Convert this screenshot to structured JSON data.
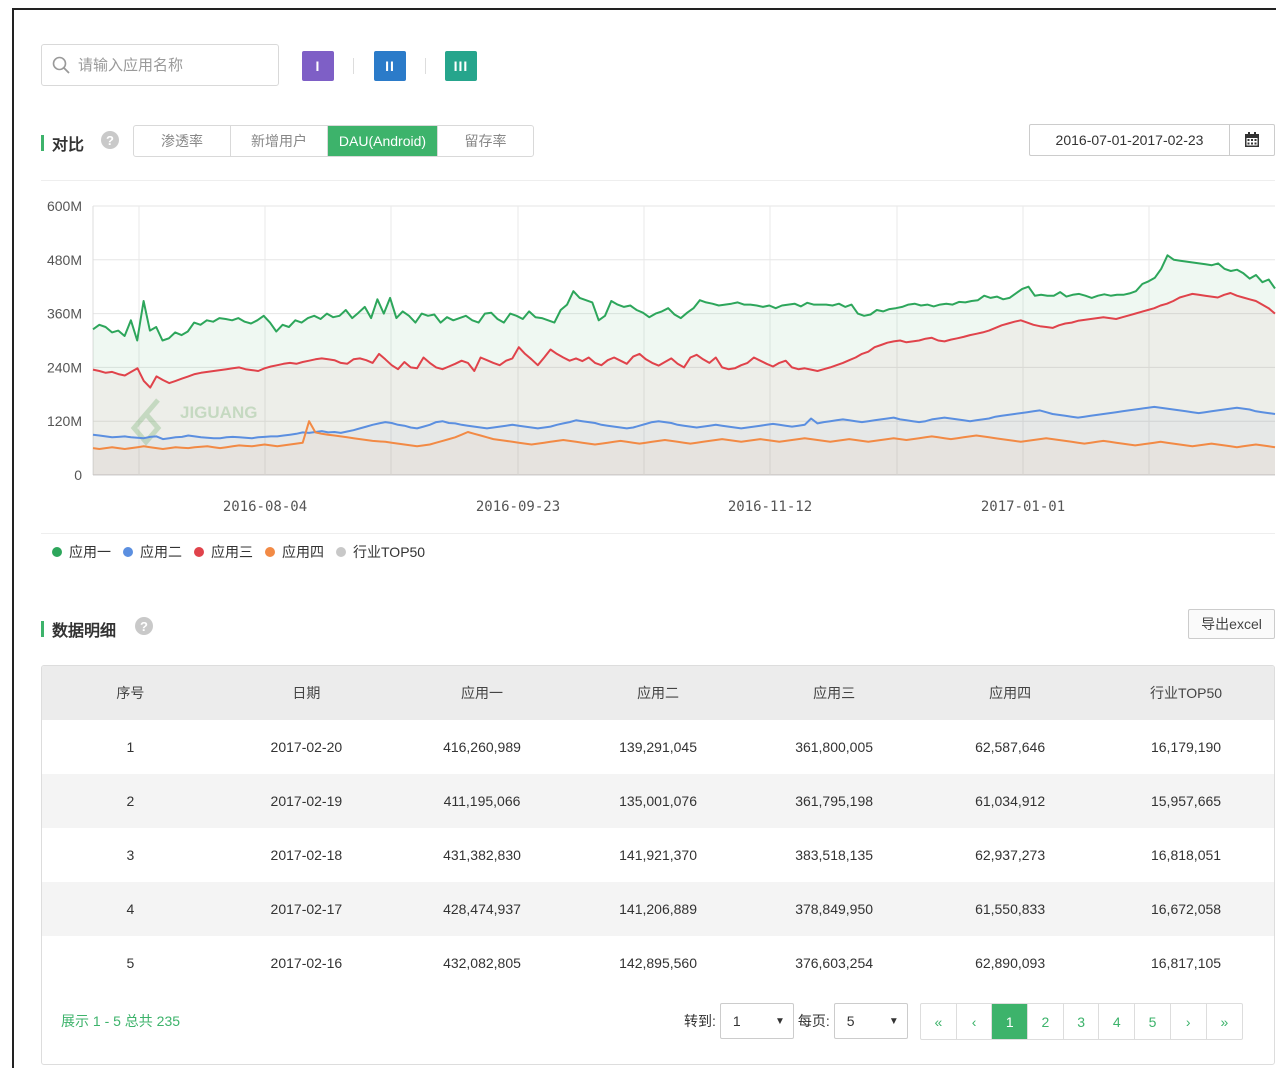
{
  "search": {
    "placeholder": "请输入应用名称"
  },
  "view_buttons": [
    {
      "label": "I",
      "color": "#7e5fc6"
    },
    {
      "label": "II",
      "color": "#2b7bc9"
    },
    {
      "label": "III",
      "color": "#26a58c"
    }
  ],
  "compare": {
    "title": "对比",
    "tabs": [
      "渗透率",
      "新增用户",
      "DAU(Android)",
      "留存率"
    ],
    "active_tab": "DAU(Android)",
    "date_range": "2016-07-01-2017-02-23"
  },
  "watermark": {
    "text": "JIGUANG"
  },
  "chart_data": {
    "type": "area",
    "x_ticks": [
      "2016-08-04",
      "2016-09-23",
      "2016-11-12",
      "2017-01-01"
    ],
    "y_ticks": [
      "0",
      "120M",
      "240M",
      "360M",
      "480M",
      "600M"
    ],
    "ylim": [
      0,
      600000000
    ],
    "x_range": [
      "2016-07-01",
      "2017-02-23"
    ],
    "grid": true,
    "legend_position": "bottom-left",
    "series": [
      {
        "name": "应用一",
        "color": "#2da65b",
        "values": [
          325,
          335,
          330,
          318,
          322,
          310,
          345,
          300,
          388,
          322,
          330,
          300,
          305,
          318,
          312,
          320,
          340,
          335,
          345,
          342,
          350,
          348,
          345,
          350,
          342,
          338,
          345,
          355,
          340,
          320,
          335,
          330,
          345,
          340,
          350,
          355,
          348,
          360,
          352,
          355,
          368,
          350,
          362,
          375,
          350,
          392,
          360,
          395,
          350,
          365,
          355,
          340,
          360,
          355,
          358,
          340,
          352,
          345,
          350,
          355,
          345,
          340,
          360,
          362,
          348,
          340,
          360,
          355,
          348,
          365,
          352,
          350,
          345,
          340,
          368,
          380,
          410,
          395,
          390,
          385,
          345,
          355,
          388,
          380,
          375,
          378,
          368,
          362,
          352,
          360,
          365,
          372,
          358,
          350,
          362,
          372,
          390,
          385,
          382,
          378,
          380,
          382,
          385,
          380,
          380,
          378,
          375,
          378,
          372,
          378,
          380,
          382,
          376,
          384,
          380,
          380,
          380,
          378,
          382,
          375,
          380,
          360,
          355,
          358,
          368,
          365,
          370,
          372,
          375,
          380,
          382,
          378,
          380,
          376,
          380,
          382,
          380,
          386,
          385,
          388,
          390,
          400,
          395,
          398,
          392,
          395,
          405,
          415,
          420,
          400,
          402,
          400,
          400,
          408,
          398,
          402,
          404,
          400,
          395,
          400,
          403,
          400,
          402,
          402,
          405,
          410,
          426,
          432,
          440,
          460,
          490,
          480,
          478,
          476,
          474,
          472,
          470,
          468,
          472,
          460,
          455,
          458,
          450,
          438,
          446,
          430,
          436,
          416
        ]
      },
      {
        "name": "应用二",
        "color": "#5b8fe0",
        "values": [
          90,
          88,
          86,
          84,
          85,
          86,
          84,
          83,
          82,
          85,
          86,
          80,
          82,
          84,
          85,
          88,
          86,
          84,
          83,
          82,
          82,
          84,
          85,
          84,
          83,
          82,
          84,
          85,
          86,
          86,
          88,
          90,
          92,
          95,
          94,
          96,
          98,
          95,
          96,
          94,
          97,
          100,
          104,
          108,
          112,
          115,
          118,
          116,
          112,
          110,
          106,
          104,
          108,
          112,
          118,
          120,
          116,
          115,
          112,
          110,
          108,
          106,
          104,
          106,
          108,
          110,
          112,
          110,
          108,
          106,
          104,
          106,
          108,
          112,
          115,
          118,
          122,
          120,
          118,
          116,
          112,
          110,
          108,
          106,
          104,
          106,
          110,
          114,
          118,
          120,
          118,
          116,
          112,
          110,
          108,
          106,
          108,
          110,
          112,
          110,
          108,
          106,
          104,
          106,
          108,
          110,
          112,
          114,
          112,
          110,
          108,
          110,
          112,
          126,
          115,
          118,
          120,
          122,
          124,
          122,
          120,
          118,
          120,
          122,
          124,
          126,
          128,
          124,
          122,
          120,
          118,
          120,
          124,
          126,
          128,
          126,
          124,
          122,
          120,
          122,
          124,
          126,
          130,
          132,
          134,
          136,
          138,
          140,
          142,
          144,
          140,
          136,
          134,
          132,
          130,
          128,
          130,
          132,
          134,
          136,
          138,
          140,
          142,
          144,
          146,
          148,
          150,
          152,
          150,
          148,
          146,
          144,
          142,
          140,
          138,
          140,
          142,
          144,
          146,
          148,
          150,
          148,
          146,
          142,
          140,
          138,
          136
        ]
      },
      {
        "name": "应用三",
        "color": "#e0434b",
        "values": [
          235,
          232,
          228,
          230,
          225,
          222,
          230,
          238,
          210,
          195,
          220,
          212,
          205,
          210,
          215,
          220,
          225,
          228,
          230,
          232,
          234,
          236,
          238,
          240,
          236,
          234,
          232,
          238,
          242,
          245,
          248,
          250,
          248,
          252,
          255,
          258,
          260,
          258,
          256,
          250,
          248,
          258,
          260,
          256,
          250,
          270,
          258,
          245,
          236,
          252,
          240,
          238,
          262,
          250,
          240,
          236,
          242,
          248,
          255,
          250,
          232,
          262,
          256,
          250,
          245,
          255,
          260,
          285,
          270,
          258,
          245,
          262,
          280,
          270,
          262,
          255,
          260,
          254,
          262,
          250,
          245,
          256,
          262,
          255,
          248,
          264,
          270,
          258,
          250,
          244,
          252,
          260,
          248,
          240,
          262,
          268,
          258,
          250,
          262,
          240,
          236,
          238,
          245,
          250,
          262,
          255,
          248,
          242,
          250,
          255,
          240,
          236,
          238,
          235,
          232,
          236,
          240,
          245,
          250,
          256,
          262,
          270,
          275,
          285,
          290,
          295,
          298,
          300,
          296,
          298,
          300,
          304,
          306,
          300,
          298,
          302,
          305,
          308,
          312,
          315,
          318,
          322,
          328,
          334,
          338,
          342,
          345,
          340,
          335,
          332,
          330,
          328,
          334,
          338,
          340,
          344,
          346,
          348,
          350,
          352,
          350,
          348,
          352,
          356,
          360,
          364,
          368,
          372,
          378,
          382,
          388,
          396,
          400,
          404,
          402,
          400,
          398,
          396,
          402,
          406,
          400,
          396,
          392,
          388,
          380,
          372,
          360
        ]
      },
      {
        "name": "应用四",
        "color": "#f28a45",
        "values": [
          60,
          58,
          60,
          62,
          60,
          58,
          60,
          62,
          64,
          62,
          60,
          58,
          60,
          62,
          61,
          60,
          62,
          63,
          64,
          62,
          60,
          62,
          64,
          66,
          65,
          64,
          66,
          68,
          66,
          64,
          66,
          68,
          70,
          72,
          120,
          95,
          92,
          90,
          88,
          86,
          84,
          82,
          80,
          78,
          76,
          75,
          74,
          72,
          70,
          68,
          66,
          64,
          66,
          68,
          72,
          76,
          80,
          84,
          90,
          96,
          92,
          88,
          84,
          80,
          78,
          76,
          74,
          72,
          70,
          68,
          70,
          72,
          74,
          76,
          78,
          76,
          74,
          72,
          70,
          68,
          70,
          72,
          74,
          76,
          74,
          72,
          70,
          72,
          74,
          76,
          78,
          76,
          74,
          72,
          70,
          72,
          74,
          76,
          78,
          80,
          78,
          76,
          74,
          76,
          78,
          80,
          78,
          76,
          74,
          76,
          78,
          80,
          82,
          80,
          78,
          76,
          74,
          76,
          78,
          80,
          78,
          76,
          74,
          76,
          78,
          80,
          82,
          80,
          78,
          80,
          82,
          84,
          86,
          84,
          82,
          80,
          82,
          84,
          86,
          88,
          86,
          84,
          82,
          80,
          78,
          76,
          74,
          76,
          78,
          80,
          82,
          80,
          78,
          76,
          74,
          72,
          70,
          72,
          74,
          76,
          74,
          72,
          70,
          68,
          66,
          68,
          70,
          72,
          74,
          72,
          70,
          68,
          66,
          64,
          66,
          68,
          70,
          68,
          66,
          64,
          62,
          64,
          66,
          68,
          66,
          64,
          62
        ]
      },
      {
        "name": "行业TOP50",
        "color": "#c8c8c8",
        "values": []
      }
    ]
  },
  "detail": {
    "title": "数据明细",
    "export_label": "导出excel",
    "columns": [
      "序号",
      "日期",
      "应用一",
      "应用二",
      "应用三",
      "应用四",
      "行业TOP50"
    ],
    "rows": [
      [
        "1",
        "2017-02-20",
        "416,260,989",
        "139,291,045",
        "361,800,005",
        "62,587,646",
        "16,179,190"
      ],
      [
        "2",
        "2017-02-19",
        "411,195,066",
        "135,001,076",
        "361,795,198",
        "61,034,912",
        "15,957,665"
      ],
      [
        "3",
        "2017-02-18",
        "431,382,830",
        "141,921,370",
        "383,518,135",
        "62,937,273",
        "16,818,051"
      ],
      [
        "4",
        "2017-02-17",
        "428,474,937",
        "141,206,889",
        "378,849,950",
        "61,550,833",
        "16,672,058"
      ],
      [
        "5",
        "2017-02-16",
        "432,082,805",
        "142,895,560",
        "376,603,254",
        "62,890,093",
        "16,817,105"
      ]
    ],
    "footer_info": "展示 1 - 5 总共 235",
    "goto_label": "转到:",
    "goto_value": "1",
    "per_page_label": "每页:",
    "per_page_value": "5",
    "pager": [
      "«",
      "‹",
      "1",
      "2",
      "3",
      "4",
      "5",
      "›",
      "»"
    ],
    "current_page": "1"
  }
}
